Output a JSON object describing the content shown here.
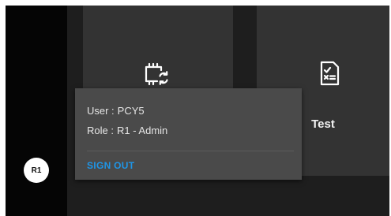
{
  "tiles": [
    {
      "label": "",
      "icon": "chip-sync-icon"
    },
    {
      "label": "Test",
      "icon": "checklist-icon"
    }
  ],
  "user_menu": {
    "avatar_initials": "R1",
    "user_label": "User :",
    "user_value": "PCY5",
    "role_label": "Role :",
    "role_value": "R1 - Admin",
    "sign_out_label": "SIGN OUT"
  },
  "colors": {
    "background": "#1e1e1e",
    "rail": "#050505",
    "tile": "#333333",
    "popup": "#4a4a4a",
    "accent": "#1f95e6"
  }
}
